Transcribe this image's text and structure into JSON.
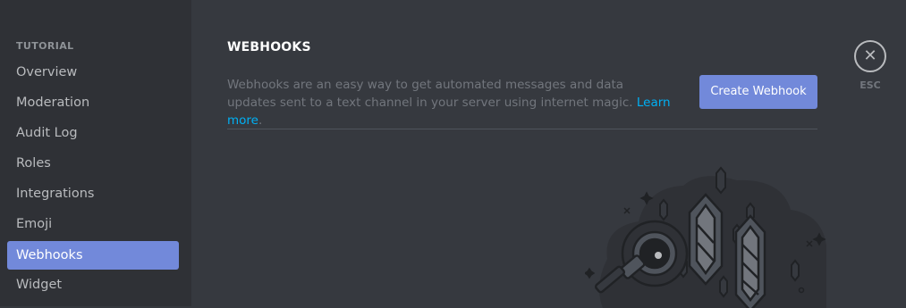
{
  "sidebar": {
    "section_title": "TUTORIAL",
    "items": [
      {
        "label": "Overview",
        "active": false
      },
      {
        "label": "Moderation",
        "active": false
      },
      {
        "label": "Audit Log",
        "active": false
      },
      {
        "label": "Roles",
        "active": false
      },
      {
        "label": "Integrations",
        "active": false
      },
      {
        "label": "Emoji",
        "active": false
      },
      {
        "label": "Webhooks",
        "active": true
      },
      {
        "label": "Widget",
        "active": false
      }
    ]
  },
  "main": {
    "title": "WEBHOOKS",
    "description": "Webhooks are an easy way to get automated messages and data updates sent to a text channel in your server using internet magic.",
    "learn_more": "Learn more",
    "period": ".",
    "create_button": "Create Webhook"
  },
  "close": {
    "icon": "close-icon",
    "label": "ESC"
  },
  "colors": {
    "background": "#36393f",
    "sidebar": "#2f3136",
    "accent": "#7289da",
    "link": "#00b0f4"
  }
}
